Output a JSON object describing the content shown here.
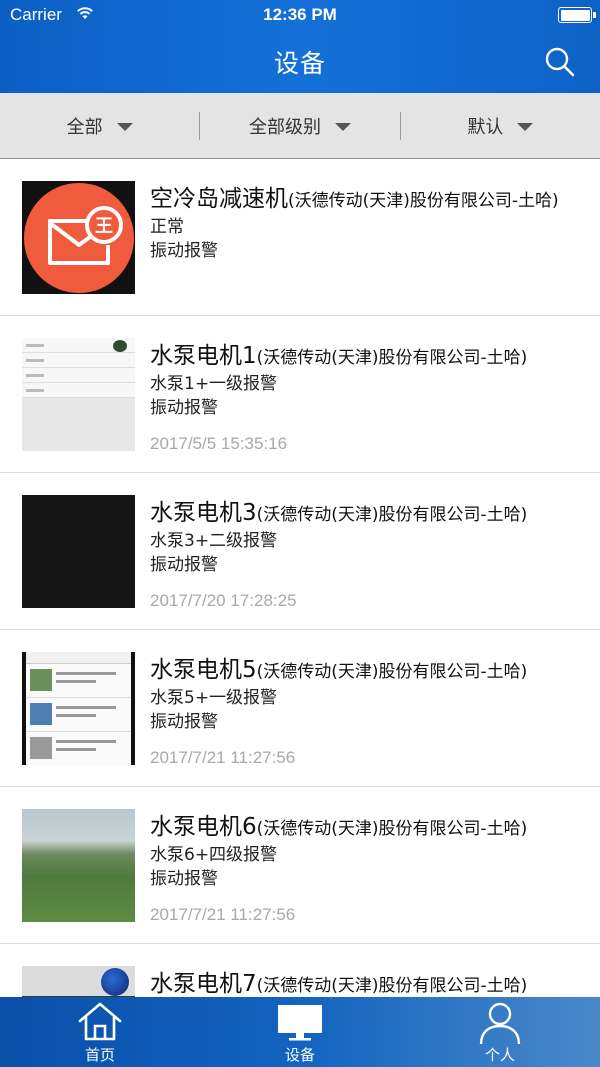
{
  "status_bar": {
    "carrier": "Carrier",
    "time": "12:36 PM"
  },
  "header": {
    "title": "设备"
  },
  "filters": [
    {
      "label": "全部"
    },
    {
      "label": "全部级别"
    },
    {
      "label": "默认"
    }
  ],
  "devices": [
    {
      "name": "空冷岛减速机",
      "company": "(沃德传动(天津)股份有限公司-土哈)",
      "line1": "正常",
      "line2": "振动报警",
      "time": ""
    },
    {
      "name": "水泵电机1",
      "company": "(沃德传动(天津)股份有限公司-土哈)",
      "line1": "水泵1+一级报警",
      "line2": "振动报警",
      "time": "2017/5/5 15:35:16"
    },
    {
      "name": "水泵电机3",
      "company": "(沃德传动(天津)股份有限公司-土哈)",
      "line1": "水泵3+二级报警",
      "line2": "振动报警",
      "time": "2017/7/20 17:28:25"
    },
    {
      "name": "水泵电机5",
      "company": "(沃德传动(天津)股份有限公司-土哈)",
      "line1": "水泵5+一级报警",
      "line2": "振动报警",
      "time": "2017/7/21 11:27:56"
    },
    {
      "name": "水泵电机6",
      "company": "(沃德传动(天津)股份有限公司-土哈)",
      "line1": "水泵6+四级报警",
      "line2": "振动报警",
      "time": "2017/7/21 11:27:56"
    },
    {
      "name": "水泵电机7",
      "company": "(沃德传动(天津)股份有限公司-土哈)",
      "line1": "",
      "line2": "",
      "time": ""
    }
  ],
  "tabbar": [
    {
      "label": "首页"
    },
    {
      "label": "设备"
    },
    {
      "label": "个人"
    }
  ],
  "colors": {
    "header_blue": "#1470d8",
    "accent_orange": "#ef5b3c",
    "filter_bg": "#e4e4e4"
  }
}
